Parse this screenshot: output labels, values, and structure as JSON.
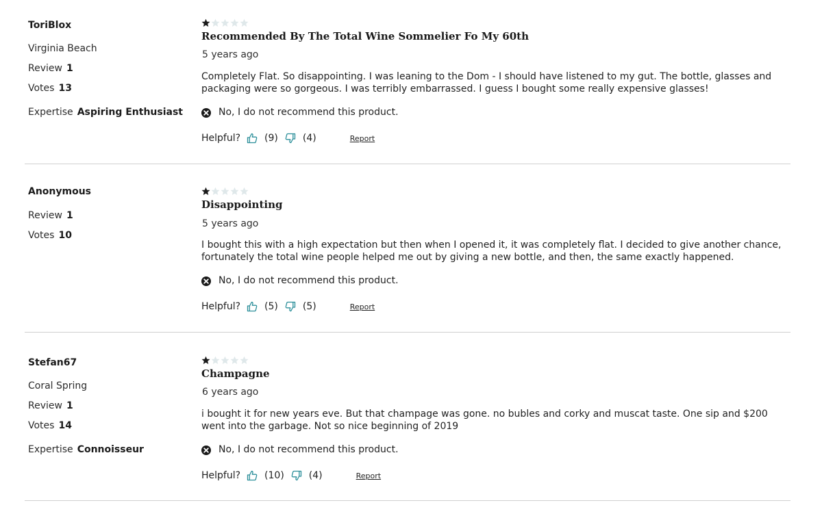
{
  "colors": {
    "star_filled": "#1a1a1a",
    "star_empty": "#dfe8ea",
    "thumb": "#2a8e99",
    "divider": "#cfcfcf"
  },
  "reviews": [
    {
      "author": "ToriBlox",
      "location": "Virginia Beach",
      "review_label": "Review",
      "review_count": "1",
      "votes_label": "Votes",
      "votes_count": "13",
      "expertise_label": "Expertise",
      "expertise_value": "Aspiring Enthusiast",
      "rating": 1,
      "rating_max": 5,
      "title": "Recommended By The Total Wine Sommelier Fo My 60th",
      "date": "5 years ago",
      "body": "Completely Flat. So disappointing. I was leaning to the Dom - I should have listened to my gut. The bottle, glasses and packaging were so gorgeous. I was terribly embarrassed. I guess I bought some really expensive glasses!",
      "recommend_text": "No, I do not recommend this product.",
      "helpful_label": "Helpful?",
      "up_count": "(9)",
      "down_count": "(4)",
      "report_label": "Report"
    },
    {
      "author": "Anonymous",
      "review_label": "Review",
      "review_count": "1",
      "votes_label": "Votes",
      "votes_count": "10",
      "rating": 1,
      "rating_max": 5,
      "title": "Disappointing",
      "date": "5 years ago",
      "body": "I bought this with a high expectation but then when I opened it, it was completely flat. I decided to give another chance, fortunately the total wine people helped me out by giving a new bottle, and then, the same exactly happened.",
      "recommend_text": "No, I do not recommend this product.",
      "helpful_label": "Helpful?",
      "up_count": "(5)",
      "down_count": "(5)",
      "report_label": "Report"
    },
    {
      "author": "Stefan67",
      "location": "Coral Spring",
      "review_label": "Review",
      "review_count": "1",
      "votes_label": "Votes",
      "votes_count": "14",
      "expertise_label": "Expertise",
      "expertise_value": "Connoisseur",
      "rating": 1,
      "rating_max": 5,
      "title": "Champagne",
      "date": "6 years ago",
      "body": "i bought it for new years eve. But that champage was gone. no bubles and corky and muscat taste. One sip and $200 went into the garbage. Not so nice beginning of 2019",
      "recommend_text": "No, I do not recommend this product.",
      "helpful_label": "Helpful?",
      "up_count": "(10)",
      "down_count": "(4)",
      "report_label": "Report"
    }
  ]
}
